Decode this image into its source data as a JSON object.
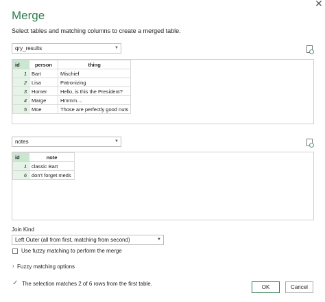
{
  "dialog": {
    "title": "Merge",
    "subtitle": "Select tables and matching columns to create a merged table."
  },
  "table1": {
    "selected": "qry_results",
    "columns": [
      "id",
      "person",
      "thing"
    ],
    "rows": [
      [
        "1",
        "Bart",
        "Mischief"
      ],
      [
        "2",
        "Lisa",
        "Patronizing"
      ],
      [
        "3",
        "Homer",
        "Hello, is this the President?"
      ],
      [
        "4",
        "Marge",
        "Hmmm...."
      ],
      [
        "5",
        "Moe",
        "Those are perfectly good nuts"
      ]
    ]
  },
  "table2": {
    "selected": "notes",
    "columns": [
      "id",
      "note"
    ],
    "rows": [
      [
        "1",
        "classic Bart"
      ],
      [
        "6",
        "don't forget meds"
      ]
    ]
  },
  "join": {
    "label": "Join Kind",
    "selected": "Left Outer (all from first, matching from second)"
  },
  "fuzzy": {
    "checkbox_label": "Use fuzzy matching to perform the merge",
    "options_label": "Fuzzy matching options"
  },
  "status": {
    "message": "The selection matches 2 of 6 rows from the first table."
  },
  "buttons": {
    "ok": "OK",
    "cancel": "Cancel"
  },
  "icons": {
    "close": "close-icon",
    "file": "file-icon",
    "check": "check-icon",
    "chevron": "chevron-right-icon",
    "caret": "chevron-down-icon"
  },
  "colors": {
    "accent": "#2f7d4f",
    "id_header": "#c9e8cf",
    "id_cell": "#e6f4e8"
  }
}
